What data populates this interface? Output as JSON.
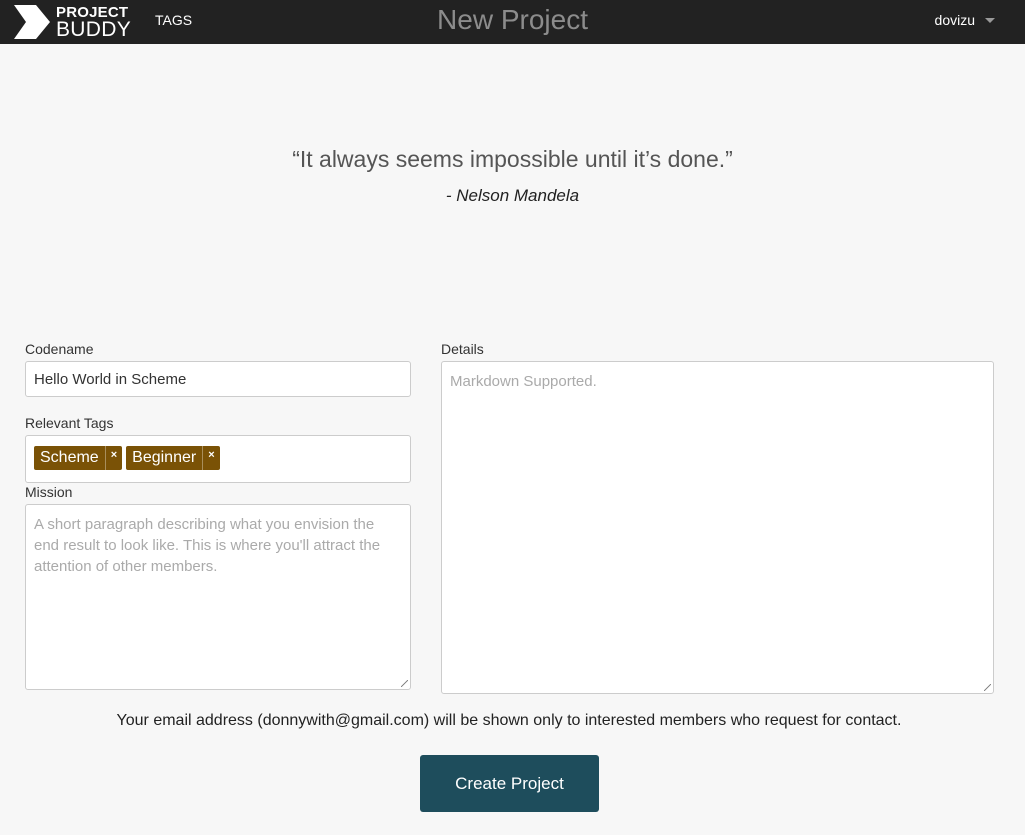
{
  "nav": {
    "logo_line1": "PROJECT",
    "logo_line2": "BUDDY",
    "tags_link": "TAGS",
    "page_title": "New Project",
    "username": "dovizu"
  },
  "quote": {
    "text": "“It always seems impossible until it’s done.”",
    "author": "- Nelson Mandela"
  },
  "form": {
    "codename": {
      "label": "Codename",
      "value": "Hello World in Scheme"
    },
    "tags": {
      "label": "Relevant Tags",
      "items": [
        {
          "label": "Scheme",
          "remove": "×"
        },
        {
          "label": "Beginner",
          "remove": "×"
        }
      ]
    },
    "mission": {
      "label": "Mission",
      "placeholder": "A short paragraph describing what you envision the end result to look like. This is where you'll attract the attention of other members."
    },
    "details": {
      "label": "Details",
      "placeholder": "Markdown Supported."
    },
    "email_note": "Your email address (donnywith@gmail.com) will be shown only to interested members who request for contact.",
    "submit_label": "Create Project"
  },
  "colors": {
    "navbar": "#222222",
    "tag": "#7a5206",
    "button": "#1e4d5c"
  }
}
